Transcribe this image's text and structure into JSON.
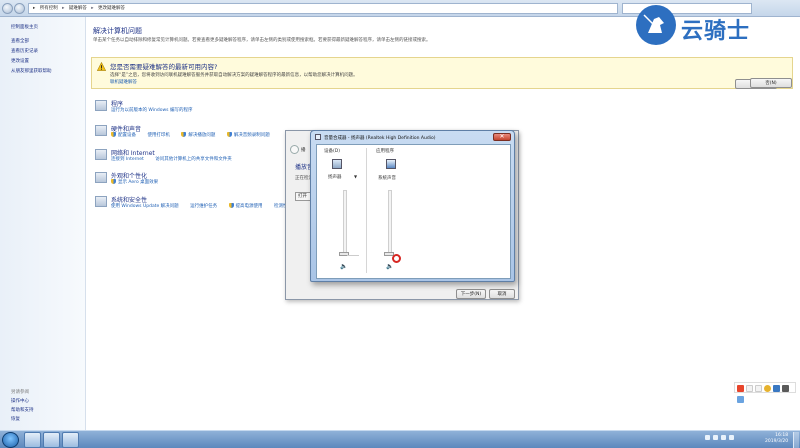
{
  "address": {
    "crumbs": [
      "所有控制",
      "疑难解答",
      "更改疑难解答"
    ],
    "separator": "▸"
  },
  "sidebar": {
    "home": "控制面板主页",
    "links": [
      "查看全部",
      "查看历史记录",
      "更改设置",
      "从朋友那里获取帮助"
    ],
    "see_also_title": "另请参阅",
    "see_also": [
      "操作中心",
      "帮助和支持",
      "恢复"
    ]
  },
  "main": {
    "title": "解决计算机问题",
    "description": "单击某个任务以自动排除和修复常见计算机问题。若要查看更多疑难解答程序，请单击左侧的类别或使用搜索框。若要获得最新疑难解答程序，请单击左侧的链接或搜索。",
    "notice": {
      "question": "您是否需要疑难解答的最新可用内容?",
      "text": "选择“是”之后，您将收到访问联机疑难解答服务并获取自动解决方案的疑难解答程序的最新信息，以帮助您解决计算机问题。",
      "link": "联机疑难解答",
      "yes": "是(Y)",
      "no": "否(N)"
    },
    "categories": [
      {
        "title": "程序",
        "links": [
          "运行为以前版本的 Windows 编写的程序"
        ]
      },
      {
        "title": "硬件和声音",
        "links": [
          "配置设备",
          "使用打印机",
          "解决播放问题",
          "解决音频录制问题"
        ]
      },
      {
        "title": "网络和 Internet",
        "links": [
          "连接到 Internet",
          "访问其他计算机上的共享文件和文件夹"
        ]
      },
      {
        "title": "外观和个性化",
        "links": [
          "显示 Aero 桌面效果"
        ]
      },
      {
        "title": "系统和安全性",
        "links": [
          "使用 Windows Update 解决问题",
          "运行维护任务",
          "提高电源使用",
          "检测性"
        ]
      }
    ]
  },
  "troubleshooter": {
    "toolbar": "播",
    "caption": "播放音",
    "text": "正在检测",
    "open_btn": "打开",
    "next": "下一步(N)",
    "cancel": "取消"
  },
  "mixer": {
    "title": "音量合成器 - 扬声器 (Realtek High Definition Audio)",
    "device_label": "设备(D)",
    "app_label": "应用程序",
    "device_name": "扬声器",
    "app_name": "系统声音",
    "close_glyph": "✕",
    "volume_device": 0,
    "volume_app": 0
  },
  "watermark": {
    "text": "云骑士"
  },
  "taskbar": {
    "time": "16:18",
    "date": "2019/3/20"
  },
  "colors": {
    "link": "#1e5fb4",
    "heading": "#1e3287",
    "notice_bg": "#fffbdc",
    "taskbar": "#5d88bd",
    "brand": "#2d6fc0"
  }
}
